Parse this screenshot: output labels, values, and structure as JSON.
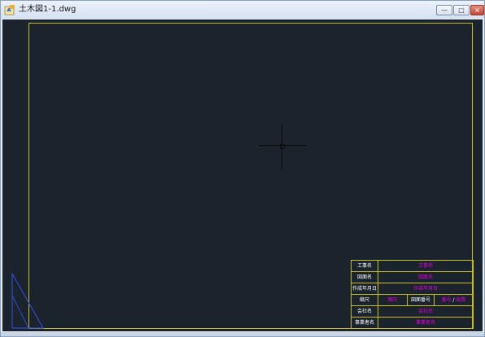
{
  "window": {
    "title": "土木図1-1.dwg",
    "app_icon": "autocad-file-icon",
    "controls": {
      "minimize": "—",
      "maximize": "□",
      "close": "×"
    }
  },
  "colors": {
    "canvas_bg": "#1b232c",
    "frame_line": "#c8c020",
    "label_text": "#ffffff",
    "value_text": "#e000e0",
    "ucs_icon": "#2c4bd0"
  },
  "title_block": {
    "project_label": "工事名",
    "project_value": "工事名",
    "drawing_label": "図面名",
    "drawing_value": "図面名",
    "date_label": "作成年月日",
    "date_value": "作成年月日",
    "scale_label": "縮尺",
    "scale_value": "縮尺",
    "number_label": "図面番号",
    "page_current": "番号",
    "page_sep": "/",
    "page_total": "総数",
    "company_label": "会社名",
    "company_value": "会社名",
    "office_label": "事業者名",
    "office_value": "事業者名"
  }
}
